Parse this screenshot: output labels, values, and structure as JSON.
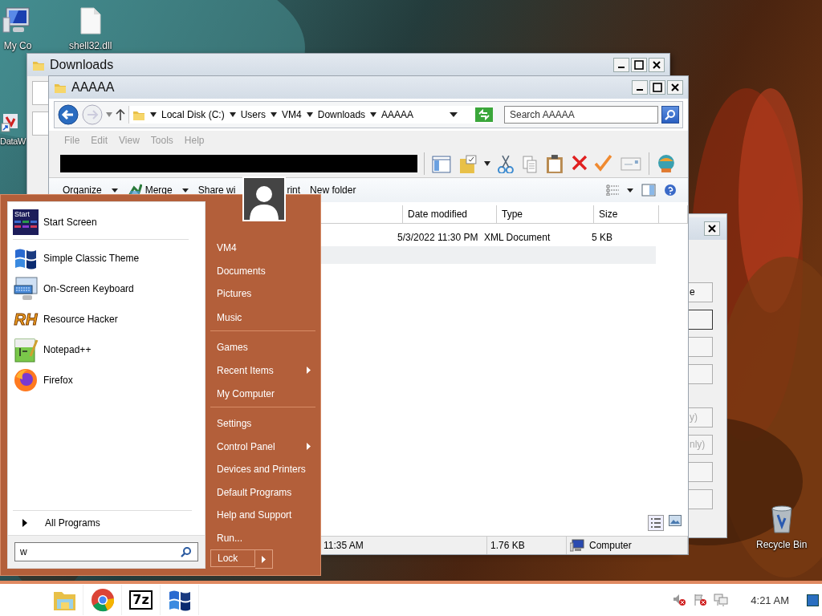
{
  "desktop_icons": [
    {
      "label": "My Co",
      "kind": "computer"
    },
    {
      "label": "shell32.dll",
      "kind": "file"
    },
    {
      "label": "DataW",
      "kind": "shortcut"
    },
    {
      "label": "Recycle Bin",
      "kind": "recycle"
    }
  ],
  "back_window": {
    "title": "Downloads"
  },
  "window": {
    "title": "AAAAA",
    "breadcrumb": [
      "Local Disk (C:)",
      "Users",
      "VM4",
      "Downloads",
      "AAAAA"
    ],
    "search": {
      "placeholder": "Search AAAAA"
    },
    "menu": [
      {
        "label": "File",
        "disabled": true
      },
      {
        "label": "Edit",
        "disabled": true
      },
      {
        "label": "View",
        "disabled": true
      },
      {
        "label": "Tools",
        "disabled": true
      },
      {
        "label": "Help",
        "disabled": true
      }
    ],
    "commands": [
      {
        "label": "Organize",
        "kind": "plain",
        "dropdown": true
      },
      {
        "label": "Merge",
        "kind": "merge",
        "dropdown": true
      },
      {
        "label": "Share wi",
        "kind": "plain",
        "dropdown": false
      },
      {
        "label": "rint",
        "kind": "plain",
        "dropdown": false
      },
      {
        "label": "New folder",
        "kind": "plain",
        "dropdown": false
      }
    ],
    "columns": [
      {
        "label": "Date modified"
      },
      {
        "label": "Type"
      },
      {
        "label": "Size"
      }
    ],
    "rows": [
      {
        "date": "5/3/2022 11:30 PM",
        "type": "XML Document",
        "size": "5 KB",
        "selected": false
      },
      {
        "selected": true
      }
    ],
    "status": [
      {
        "text": "11:35 AM",
        "kind": "plain"
      },
      {
        "text": "1.76 KB",
        "kind": "plain"
      },
      {
        "text": "Computer",
        "kind": "computer"
      }
    ]
  },
  "dialog": {
    "buttons": [
      {
        "label": "e",
        "focused": false,
        "disabled": false
      },
      {
        "focused": true
      },
      {
        "focused": false
      },
      {
        "focused": false
      },
      {
        "label": "y)",
        "focused": false,
        "disabled": true
      },
      {
        "label": "nly)",
        "focused": false,
        "disabled": true
      },
      {
        "focused": false
      },
      {
        "focused": false
      }
    ]
  },
  "start_menu": {
    "pinned": [
      {
        "label": "Start Screen",
        "kind": "tile",
        "icon_text": "Start",
        "separator_after": true
      },
      {
        "label": "Simple Classic Theme",
        "kind": "windows",
        "separator_after": false
      },
      {
        "label": "On-Screen Keyboard",
        "kind": "keyboard",
        "separator_after": false
      },
      {
        "label": "Resource Hacker",
        "kind": "letters",
        "icon_text": "RH",
        "separator_after": false
      },
      {
        "label": "Notepad++",
        "kind": "notepad",
        "separator_after": false
      },
      {
        "label": "Firefox",
        "kind": "firefox",
        "separator_after": false
      }
    ],
    "all_programs": "All Programs",
    "search": {
      "value": "w"
    },
    "places": [
      {
        "label": "VM4",
        "submenu": false,
        "separator_after": false
      },
      {
        "label": "Documents",
        "submenu": false,
        "separator_after": false
      },
      {
        "label": "Pictures",
        "submenu": false,
        "separator_after": false
      },
      {
        "label": "Music",
        "submenu": false,
        "separator_after": true
      },
      {
        "label": "Games",
        "submenu": false,
        "separator_after": false
      },
      {
        "label": "Recent Items",
        "submenu": true,
        "separator_after": false
      },
      {
        "label": "My Computer",
        "submenu": false,
        "separator_after": true
      },
      {
        "label": "Settings",
        "submenu": false,
        "separator_after": false
      },
      {
        "label": "Control Panel",
        "submenu": true,
        "separator_after": false
      },
      {
        "label": "Devices and Printers",
        "submenu": false,
        "separator_after": false
      },
      {
        "label": "Default Programs",
        "submenu": false,
        "separator_after": false
      },
      {
        "label": "Help and Support",
        "submenu": false,
        "separator_after": false
      },
      {
        "label": "Run...",
        "submenu": false,
        "separator_after": false
      }
    ],
    "lock": "Lock"
  },
  "taskbar": {
    "apps": [
      {
        "kind": "explorer"
      },
      {
        "kind": "chrome"
      },
      {
        "kind": "letters",
        "icon_text": "7z"
      },
      {
        "kind": "windows"
      }
    ],
    "clock": "4:21 AM"
  }
}
